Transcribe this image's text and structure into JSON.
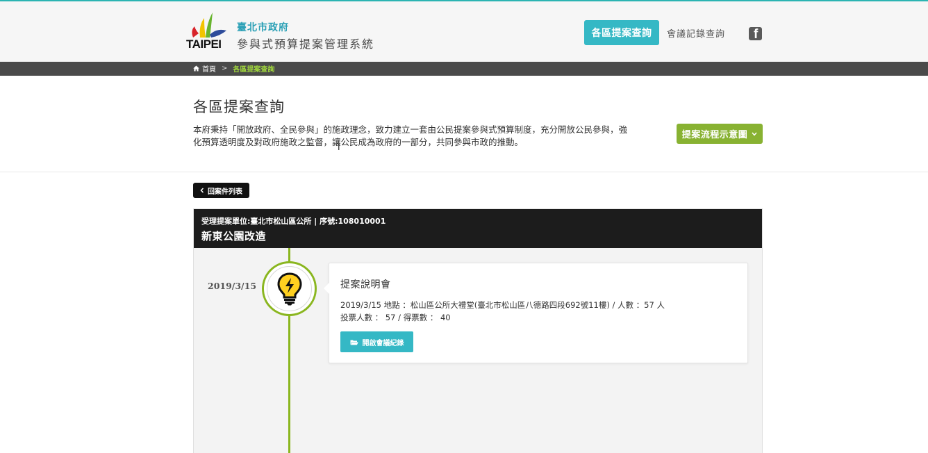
{
  "header": {
    "logo_text": "TAIPEI",
    "brand_title": "臺北市政府",
    "brand_subtitle": "參與式預算提案管理系統",
    "nav_items": [
      {
        "label": "各區提案查詢",
        "active": true
      },
      {
        "label": "會議記錄查詢",
        "active": false
      }
    ],
    "social_icon": "facebook-icon"
  },
  "breadcrumb": {
    "home_icon": "home-icon",
    "home": "首頁",
    "separator": ">",
    "current": "各區提案查詢"
  },
  "intro": {
    "title": "各區提案查詢",
    "description_line1": "本府秉持「開放政府、全民參與」的施政理念，致力建立一套由公民提案參與式預算制度，充分開放公民參與，強",
    "description_line2": "化預算透明度及對政府施政之監督，讓公民成為政府的一部分，共同參與市政的推動。",
    "flow_button": "提案流程示意圖"
  },
  "back_button": "回案件列表",
  "case": {
    "meta": "受理提案單位:臺北市松山區公所 | 序號:108010001",
    "title": "新東公園改造"
  },
  "timeline": [
    {
      "date": "2019/3/15",
      "icon": "lightbulb-icon",
      "stage": "提案說明會",
      "detail_line1": "2019/3/15 地點 ：松山區公所大禮堂(臺北市松山區八德路四段692號11樓) / 人數 ：57 人",
      "detail_line2": "投票人數 ： 57 / 得票數 ： 40",
      "record_button": "開啟會議紀錄"
    }
  ],
  "colors": {
    "accent_teal": "#35b8c5",
    "accent_green": "#88b232",
    "timeline_green": "#8ab61f",
    "breadcrumb_current": "#9fd43d"
  }
}
